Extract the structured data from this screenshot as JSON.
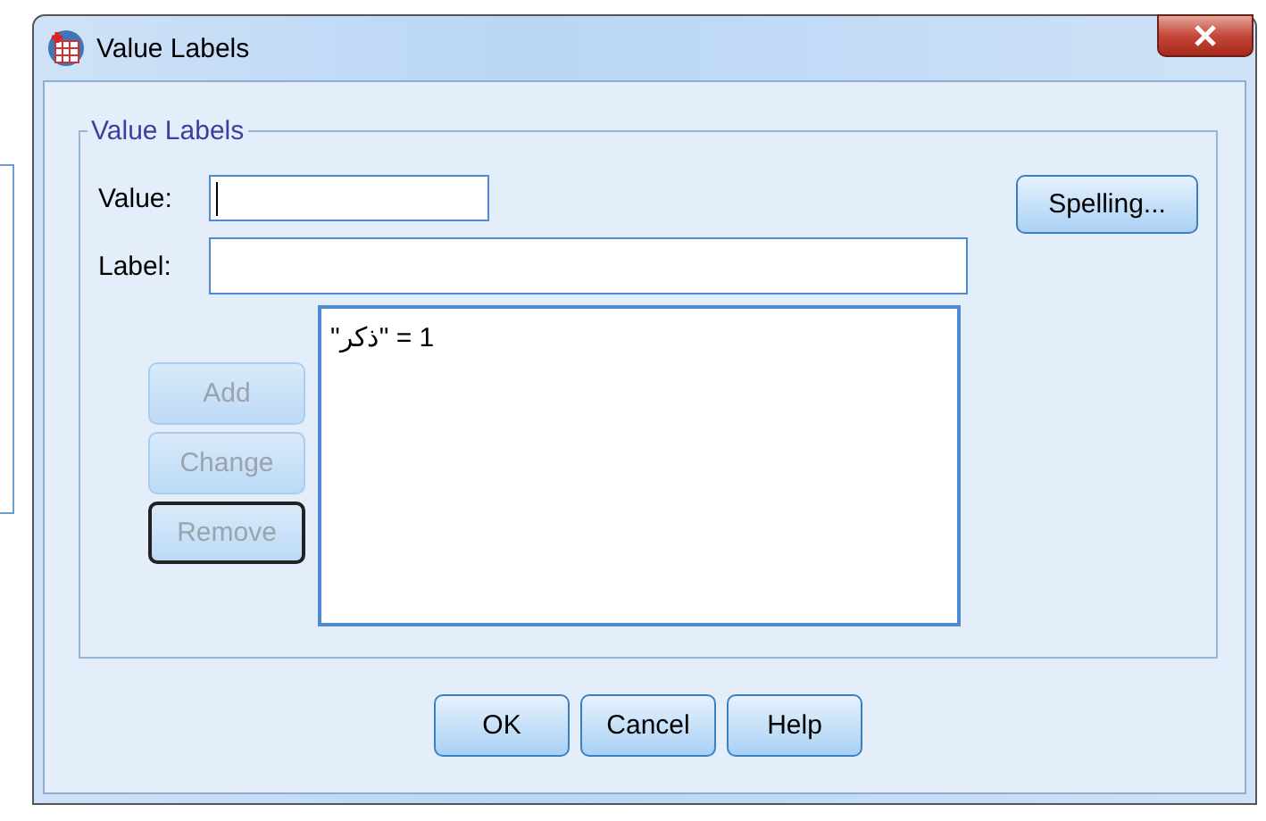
{
  "window": {
    "title": "Value Labels"
  },
  "group": {
    "title": "Value Labels"
  },
  "fields": [
    {
      "label": "Value:",
      "focused": true
    },
    {
      "label": "Label:",
      "focused": false
    }
  ],
  "spelling_button": "Spelling...",
  "side_buttons": [
    {
      "label": "Add",
      "disabled": true,
      "focused": false
    },
    {
      "label": "Change",
      "disabled": true,
      "focused": false
    },
    {
      "label": "Remove",
      "disabled": true,
      "focused": true
    }
  ],
  "labels_list": [
    {
      "text": "1 = \"ذكر\"",
      "selected": false
    }
  ],
  "buttons": [
    "OK",
    "Cancel",
    "Help"
  ]
}
